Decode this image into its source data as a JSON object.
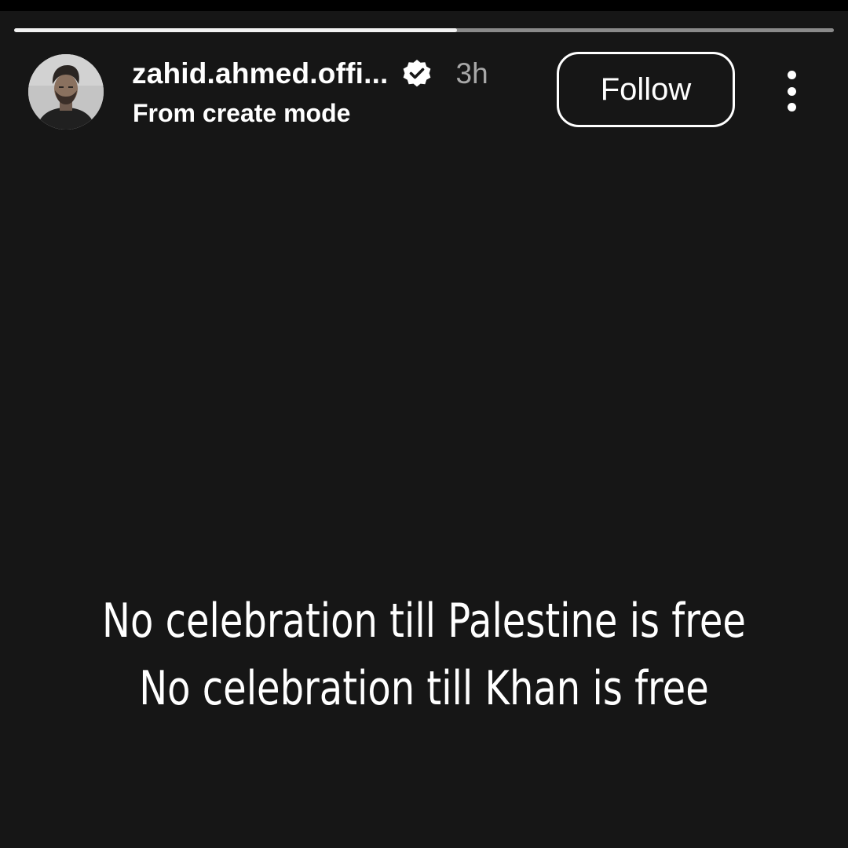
{
  "story": {
    "progress_fraction": 0.54,
    "header": {
      "username": "zahid.ahmed.offi...",
      "verified": true,
      "time_ago": "3h",
      "subtitle": "From create mode",
      "follow_label": "Follow",
      "more_icon": "more-vertical-icon"
    },
    "content": {
      "line1": "No celebration till Palestine is free",
      "line2": "No celebration till Khan is free"
    }
  },
  "colors": {
    "background": "#161616",
    "progress_filled": "#f2f2f2",
    "progress_track": "#8a8a8a",
    "text": "#ffffff",
    "muted_text": "#a8a8a8"
  }
}
